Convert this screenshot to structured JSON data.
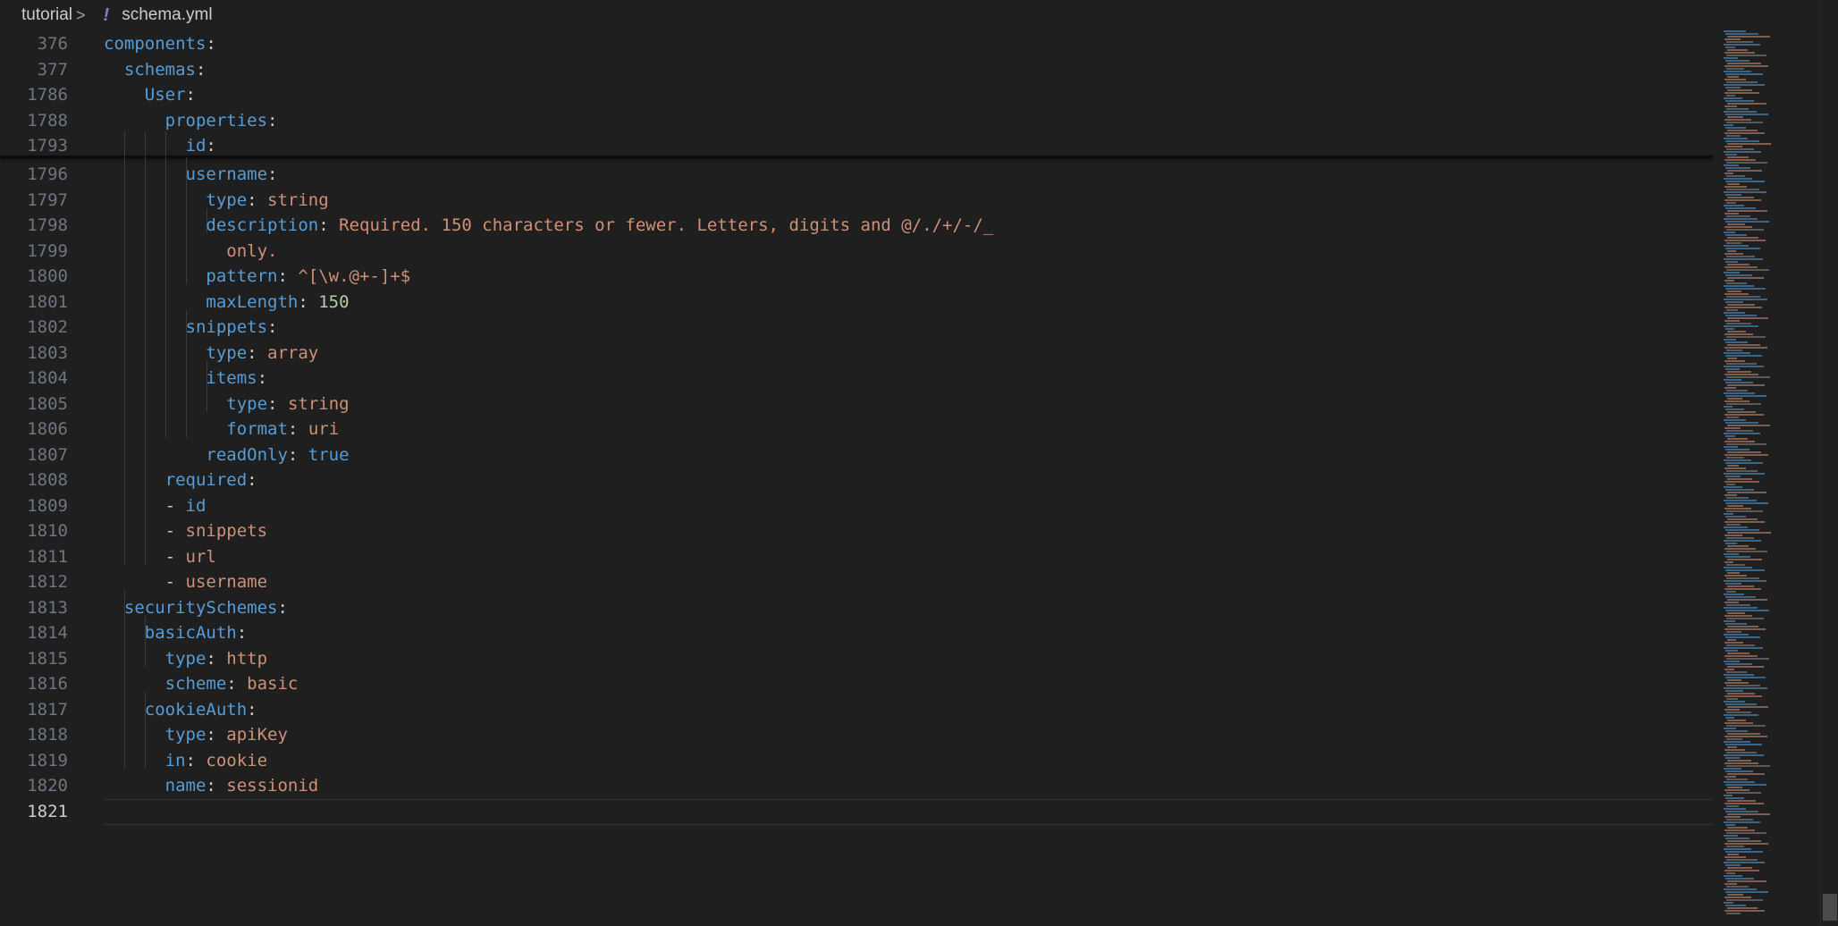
{
  "breadcrumb": {
    "folder": "tutorial",
    "separator": ">",
    "file_icon": "!",
    "file": "schema.yml"
  },
  "colors": {
    "background": "#1f1f1f",
    "key": "#569cd6",
    "string": "#ce9178",
    "number": "#b5cea8",
    "line_number": "#6e7681"
  },
  "sticky": [
    {
      "num": "376",
      "tokens": [
        {
          "t": "components",
          "c": "k"
        },
        {
          "t": ":",
          "c": "p"
        }
      ]
    },
    {
      "num": "377",
      "tokens": [
        {
          "t": "  "
        },
        {
          "t": "schemas",
          "c": "k"
        },
        {
          "t": ":",
          "c": "p"
        }
      ]
    },
    {
      "num": "1786",
      "tokens": [
        {
          "t": "    "
        },
        {
          "t": "User",
          "c": "k"
        },
        {
          "t": ":",
          "c": "p"
        }
      ]
    },
    {
      "num": "1788",
      "tokens": [
        {
          "t": "      "
        },
        {
          "t": "properties",
          "c": "k"
        },
        {
          "t": ":",
          "c": "p"
        }
      ]
    },
    {
      "num": "1793",
      "tokens": [
        {
          "t": "        "
        },
        {
          "t": "id",
          "c": "k"
        },
        {
          "t": ":",
          "c": "p"
        }
      ]
    }
  ],
  "lines": [
    {
      "num": "1796",
      "tokens": [
        {
          "t": "        "
        },
        {
          "t": "username",
          "c": "k"
        },
        {
          "t": ":",
          "c": "p"
        }
      ]
    },
    {
      "num": "1797",
      "tokens": [
        {
          "t": "          "
        },
        {
          "t": "type",
          "c": "k"
        },
        {
          "t": ": ",
          "c": "p"
        },
        {
          "t": "string",
          "c": "s"
        }
      ]
    },
    {
      "num": "1798",
      "tokens": [
        {
          "t": "          "
        },
        {
          "t": "description",
          "c": "k"
        },
        {
          "t": ": ",
          "c": "p"
        },
        {
          "t": "Required. 150 characters or fewer. Letters, digits and @/./+/-/_",
          "c": "s"
        }
      ]
    },
    {
      "num": "1799",
      "tokens": [
        {
          "t": "            "
        },
        {
          "t": "only.",
          "c": "s"
        }
      ]
    },
    {
      "num": "1800",
      "tokens": [
        {
          "t": "          "
        },
        {
          "t": "pattern",
          "c": "k"
        },
        {
          "t": ": ",
          "c": "p"
        },
        {
          "t": "^[\\w.@+-]+$",
          "c": "s"
        }
      ]
    },
    {
      "num": "1801",
      "tokens": [
        {
          "t": "          "
        },
        {
          "t": "maxLength",
          "c": "k"
        },
        {
          "t": ": ",
          "c": "p"
        },
        {
          "t": "150",
          "c": "n"
        }
      ]
    },
    {
      "num": "1802",
      "tokens": [
        {
          "t": "        "
        },
        {
          "t": "snippets",
          "c": "k"
        },
        {
          "t": ":",
          "c": "p"
        }
      ]
    },
    {
      "num": "1803",
      "tokens": [
        {
          "t": "          "
        },
        {
          "t": "type",
          "c": "k"
        },
        {
          "t": ": ",
          "c": "p"
        },
        {
          "t": "array",
          "c": "s"
        }
      ]
    },
    {
      "num": "1804",
      "tokens": [
        {
          "t": "          "
        },
        {
          "t": "items",
          "c": "k"
        },
        {
          "t": ":",
          "c": "p"
        }
      ]
    },
    {
      "num": "1805",
      "tokens": [
        {
          "t": "            "
        },
        {
          "t": "type",
          "c": "k"
        },
        {
          "t": ": ",
          "c": "p"
        },
        {
          "t": "string",
          "c": "s"
        }
      ]
    },
    {
      "num": "1806",
      "tokens": [
        {
          "t": "            "
        },
        {
          "t": "format",
          "c": "k"
        },
        {
          "t": ": ",
          "c": "p"
        },
        {
          "t": "uri",
          "c": "s"
        }
      ]
    },
    {
      "num": "1807",
      "tokens": [
        {
          "t": "          "
        },
        {
          "t": "readOnly",
          "c": "k"
        },
        {
          "t": ": ",
          "c": "p"
        },
        {
          "t": "true",
          "c": "b"
        }
      ]
    },
    {
      "num": "1808",
      "tokens": [
        {
          "t": "      "
        },
        {
          "t": "required",
          "c": "k"
        },
        {
          "t": ":",
          "c": "p"
        }
      ]
    },
    {
      "num": "1809",
      "tokens": [
        {
          "t": "      "
        },
        {
          "t": "- ",
          "c": "p"
        },
        {
          "t": "id",
          "c": "k"
        }
      ]
    },
    {
      "num": "1810",
      "tokens": [
        {
          "t": "      "
        },
        {
          "t": "- ",
          "c": "p"
        },
        {
          "t": "snippets",
          "c": "s"
        }
      ]
    },
    {
      "num": "1811",
      "tokens": [
        {
          "t": "      "
        },
        {
          "t": "- ",
          "c": "p"
        },
        {
          "t": "url",
          "c": "s"
        }
      ]
    },
    {
      "num": "1812",
      "tokens": [
        {
          "t": "      "
        },
        {
          "t": "- ",
          "c": "p"
        },
        {
          "t": "username",
          "c": "s"
        }
      ]
    },
    {
      "num": "1813",
      "tokens": [
        {
          "t": "  "
        },
        {
          "t": "securitySchemes",
          "c": "k"
        },
        {
          "t": ":",
          "c": "p"
        }
      ]
    },
    {
      "num": "1814",
      "tokens": [
        {
          "t": "    "
        },
        {
          "t": "basicAuth",
          "c": "k"
        },
        {
          "t": ":",
          "c": "p"
        }
      ]
    },
    {
      "num": "1815",
      "tokens": [
        {
          "t": "      "
        },
        {
          "t": "type",
          "c": "k"
        },
        {
          "t": ": ",
          "c": "p"
        },
        {
          "t": "http",
          "c": "s"
        }
      ]
    },
    {
      "num": "1816",
      "tokens": [
        {
          "t": "      "
        },
        {
          "t": "scheme",
          "c": "k"
        },
        {
          "t": ": ",
          "c": "p"
        },
        {
          "t": "basic",
          "c": "s"
        }
      ]
    },
    {
      "num": "1817",
      "tokens": [
        {
          "t": "    "
        },
        {
          "t": "cookieAuth",
          "c": "k"
        },
        {
          "t": ":",
          "c": "p"
        }
      ]
    },
    {
      "num": "1818",
      "tokens": [
        {
          "t": "      "
        },
        {
          "t": "type",
          "c": "k"
        },
        {
          "t": ": ",
          "c": "p"
        },
        {
          "t": "apiKey",
          "c": "s"
        }
      ]
    },
    {
      "num": "1819",
      "tokens": [
        {
          "t": "      "
        },
        {
          "t": "in",
          "c": "k"
        },
        {
          "t": ": ",
          "c": "p"
        },
        {
          "t": "cookie",
          "c": "s"
        }
      ]
    },
    {
      "num": "1820",
      "tokens": [
        {
          "t": "      "
        },
        {
          "t": "name",
          "c": "k"
        },
        {
          "t": ": ",
          "c": "p"
        },
        {
          "t": "sessionid",
          "c": "s"
        }
      ]
    },
    {
      "num": "1821",
      "tokens": [],
      "active": true
    }
  ]
}
